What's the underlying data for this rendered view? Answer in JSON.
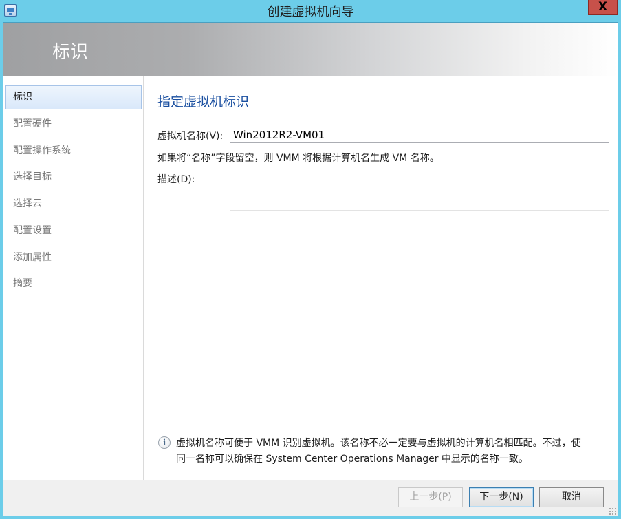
{
  "window": {
    "title": "创建虚拟机向导",
    "close_glyph": "X",
    "titlebar_color": "#6ccde9",
    "app_icon": "vmm-wizard-icon"
  },
  "banner": {
    "title": "标识"
  },
  "sidebar": {
    "items": [
      {
        "label": "标识",
        "active": true
      },
      {
        "label": "配置硬件",
        "active": false
      },
      {
        "label": "配置操作系统",
        "active": false
      },
      {
        "label": "选择目标",
        "active": false
      },
      {
        "label": "选择云",
        "active": false
      },
      {
        "label": "配置设置",
        "active": false
      },
      {
        "label": "添加属性",
        "active": false
      },
      {
        "label": "摘要",
        "active": false
      }
    ]
  },
  "main": {
    "heading": "指定虚拟机标识",
    "name_label": "虚拟机名称(V):",
    "name_value": "Win2012R2-VM01",
    "hint": "如果将“名称”字段留空，则 VMM 将根据计算机名生成 VM 名称。",
    "description_label": "描述(D):",
    "description_value": "",
    "info_icon": "info-icon",
    "info_line1": "虚拟机名称可便于 VMM 识别虚拟机。该名称不必一定要与虚拟机的计算机名相匹配。不过，使",
    "info_line2": "同一名称可以确保在 System Center Operations Manager 中显示的名称一致。"
  },
  "footer": {
    "back_label": "上一步(P)",
    "back_enabled": false,
    "next_label": "下一步(N)",
    "cancel_label": "取消"
  },
  "colors": {
    "accent": "#1a4fa0",
    "active_nav_bg": "#d9e8fa",
    "close_button": "#c7514a"
  }
}
